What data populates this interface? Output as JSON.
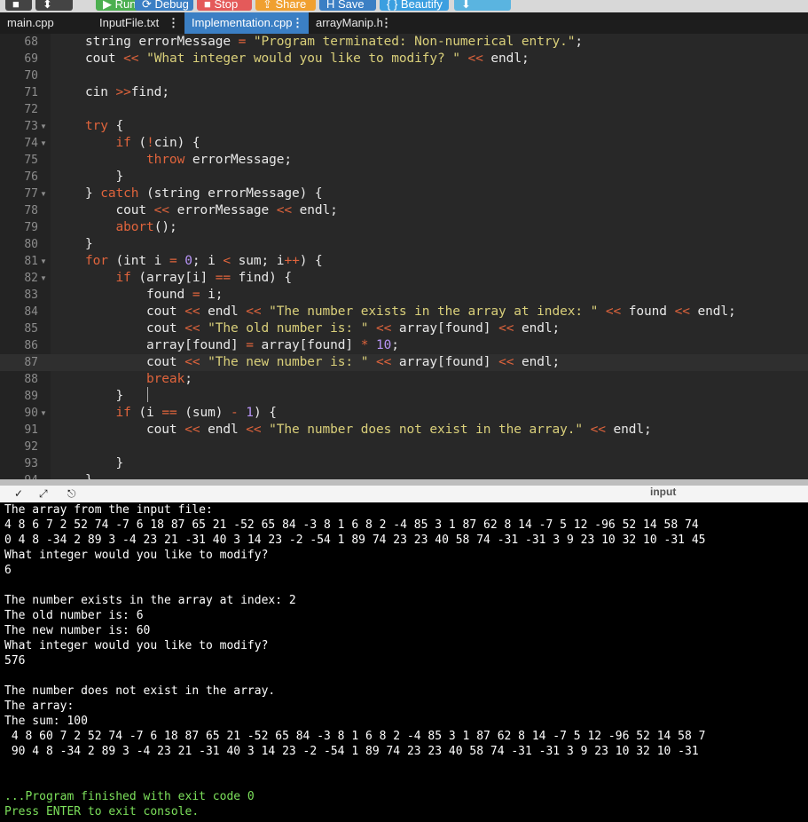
{
  "toolbar": {
    "buttons": [
      {
        "label": "■",
        "color": "#444444"
      },
      {
        "label": "⬍",
        "color": "#444444"
      },
      {
        "label": "▶ Run",
        "color": "#4caf50"
      },
      {
        "label": "⟳ Debug",
        "color": "#3b7fc4"
      },
      {
        "label": "■ Stop",
        "color": "#e45a5a"
      },
      {
        "label": "⇪ Share",
        "color": "#f0a030"
      },
      {
        "label": "H Save",
        "color": "#3b7fc4"
      },
      {
        "label": "{ } Beautify",
        "color": "#3b9fe0"
      },
      {
        "label": "⬇",
        "color": "#5ab4e0"
      }
    ]
  },
  "tabs": [
    {
      "label": "main.cpp",
      "active": false,
      "menu": ""
    },
    {
      "label": "InputFile.txt",
      "active": false,
      "menu": "⋮"
    },
    {
      "label": "Implementation.cpp",
      "active": true,
      "menu": "⋮"
    },
    {
      "label": "arrayManip.h",
      "active": false,
      "menu": "⋮"
    }
  ],
  "code": [
    {
      "n": "68",
      "fold": false,
      "html": "string errorMessage <span class=\"op\">=</span> <span class=\"str\">\"Program terminated: Non-numerical entry.\"</span>;"
    },
    {
      "n": "69",
      "fold": false,
      "html": "cout <span class=\"op\">&lt;&lt;</span> <span class=\"str\">\"What integer would you like to modify? \"</span> <span class=\"op\">&lt;&lt;</span> endl;"
    },
    {
      "n": "70",
      "fold": false,
      "html": ""
    },
    {
      "n": "71",
      "fold": false,
      "html": "cin <span class=\"op\">&gt;&gt;</span>find;"
    },
    {
      "n": "72",
      "fold": false,
      "html": ""
    },
    {
      "n": "73",
      "fold": true,
      "html": "<span class=\"kw\">try</span> {"
    },
    {
      "n": "74",
      "fold": true,
      "html": "    <span class=\"kw\">if</span> (<span class=\"op\">!</span>cin) {"
    },
    {
      "n": "75",
      "fold": false,
      "html": "        <span class=\"kw\">throw</span> errorMessage;"
    },
    {
      "n": "76",
      "fold": false,
      "html": "    }"
    },
    {
      "n": "77",
      "fold": true,
      "html": "} <span class=\"kw\">catch</span> (string errorMessage) {"
    },
    {
      "n": "78",
      "fold": false,
      "html": "    cout <span class=\"op\">&lt;&lt;</span> errorMessage <span class=\"op\">&lt;&lt;</span> endl;"
    },
    {
      "n": "79",
      "fold": false,
      "html": "    <span class=\"kw\">abort</span>();"
    },
    {
      "n": "80",
      "fold": false,
      "html": "}"
    },
    {
      "n": "81",
      "fold": true,
      "html": "<span class=\"kw\">for</span> (int i <span class=\"op\">=</span> <span class=\"num\">0</span>; i <span class=\"op\">&lt;</span> sum; i<span class=\"op\">++</span>) {"
    },
    {
      "n": "82",
      "fold": true,
      "html": "    <span class=\"kw\">if</span> (array[i] <span class=\"op\">==</span> find) {"
    },
    {
      "n": "83",
      "fold": false,
      "html": "        found <span class=\"op\">=</span> i;"
    },
    {
      "n": "84",
      "fold": false,
      "html": "        cout <span class=\"op\">&lt;&lt;</span> endl <span class=\"op\">&lt;&lt;</span> <span class=\"str\">\"The number exists in the array at index: \"</span> <span class=\"op\">&lt;&lt;</span> found <span class=\"op\">&lt;&lt;</span> endl;"
    },
    {
      "n": "85",
      "fold": false,
      "html": "        cout <span class=\"op\">&lt;&lt;</span> <span class=\"str\">\"The old number is: \"</span> <span class=\"op\">&lt;&lt;</span> array[found] <span class=\"op\">&lt;&lt;</span> endl;"
    },
    {
      "n": "86",
      "fold": false,
      "html": "        array[found] <span class=\"op\">=</span> array[found] <span class=\"op\">*</span> <span class=\"num\">10</span>;"
    },
    {
      "n": "87",
      "fold": false,
      "html": "        cout <span class=\"op\">&lt;&lt;</span> <span class=\"str\">\"The new number is: \"</span> <span class=\"op\">&lt;&lt;</span> array[found] <span class=\"op\">&lt;&lt;</span> endl;"
    },
    {
      "n": "88",
      "fold": false,
      "html": "        <span class=\"kw\">break</span>;"
    },
    {
      "n": "89",
      "fold": false,
      "html": "    }"
    },
    {
      "n": "90",
      "fold": true,
      "html": "    <span class=\"kw\">if</span> (i <span class=\"op\">==</span> (sum) <span class=\"op\">-</span> <span class=\"num\">1</span>) {"
    },
    {
      "n": "91",
      "fold": false,
      "html": "        cout <span class=\"op\">&lt;&lt;</span> endl <span class=\"op\">&lt;&lt;</span> <span class=\"str\">\"The number does not exist in the array.\"</span> <span class=\"op\">&lt;&lt;</span> endl;"
    },
    {
      "n": "92",
      "fold": false,
      "html": ""
    },
    {
      "n": "93",
      "fold": false,
      "html": "    }"
    },
    {
      "n": "94",
      "fold": false,
      "html": "}"
    }
  ],
  "panel": {
    "input_label": "input"
  },
  "console": [
    {
      "text": "The array from the input file:",
      "green": false
    },
    {
      "text": "4 8 6 7 2 52 74 -7 6 18 87 65 21 -52 65 84 -3 8 1 6 8 2 -4 85 3 1 87 62 8 14 -7 5 12 -96 52 14 58 74",
      "green": false
    },
    {
      "text": "0 4 8 -34 2 89 3 -4 23 21 -31 40 3 14 23 -2 -54 1 89 74 23 23 40 58 74 -31 -31 3 9 23 10 32 10 -31 45",
      "green": false
    },
    {
      "text": "What integer would you like to modify?",
      "green": false
    },
    {
      "text": "6",
      "green": false
    },
    {
      "text": "",
      "green": false
    },
    {
      "text": "The number exists in the array at index: 2",
      "green": false
    },
    {
      "text": "The old number is: 6",
      "green": false
    },
    {
      "text": "The new number is: 60",
      "green": false
    },
    {
      "text": "What integer would you like to modify?",
      "green": false
    },
    {
      "text": "576",
      "green": false
    },
    {
      "text": "",
      "green": false
    },
    {
      "text": "The number does not exist in the array.",
      "green": false
    },
    {
      "text": "The array:",
      "green": false
    },
    {
      "text": "The sum: 100",
      "green": false
    },
    {
      "text": " 4 8 60 7 2 52 74 -7 6 18 87 65 21 -52 65 84 -3 8 1 6 8 2 -4 85 3 1 87 62 8 14 -7 5 12 -96 52 14 58 7",
      "green": false
    },
    {
      "text": " 90 4 8 -34 2 89 3 -4 23 21 -31 40 3 14 23 -2 -54 1 89 74 23 23 40 58 74 -31 -31 3 9 23 10 32 10 -31",
      "green": false
    },
    {
      "text": "",
      "green": false
    },
    {
      "text": "",
      "green": false
    },
    {
      "text": "...Program finished with exit code 0",
      "green": true
    },
    {
      "text": "Press ENTER to exit console.",
      "green": true
    }
  ]
}
